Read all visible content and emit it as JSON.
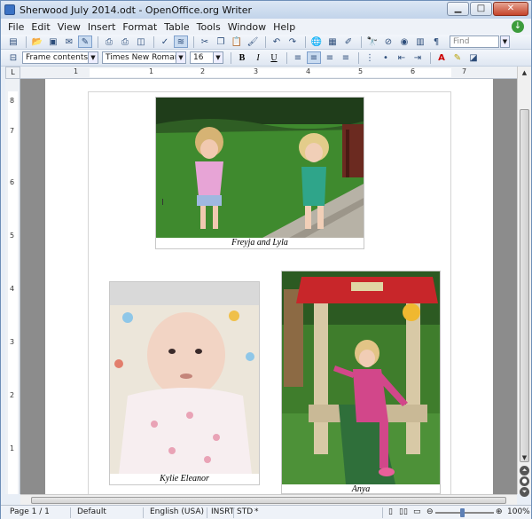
{
  "window": {
    "title": "Sherwood July 2014.odt - OpenOffice.org Writer"
  },
  "menu": [
    {
      "label": "File",
      "u": "F"
    },
    {
      "label": "Edit",
      "u": "E"
    },
    {
      "label": "View",
      "u": "V"
    },
    {
      "label": "Insert",
      "u": "I"
    },
    {
      "label": "Format",
      "u": "o"
    },
    {
      "label": "Table",
      "u": "a"
    },
    {
      "label": "Tools",
      "u": "T"
    },
    {
      "label": "Window",
      "u": "W"
    },
    {
      "label": "Help",
      "u": "H"
    }
  ],
  "toolbar": {
    "find_placeholder": "Find"
  },
  "format_bar": {
    "style": "Frame contents",
    "font": "Times New Roman",
    "size": "16"
  },
  "ruler": {
    "numbers": [
      "1",
      "1",
      "2",
      "3",
      "4",
      "5",
      "6",
      "7"
    ],
    "vnumbers": [
      "1",
      "2",
      "3",
      "4",
      "5",
      "6",
      "7",
      "8"
    ]
  },
  "photos": [
    {
      "caption": "Freyja and Lyla"
    },
    {
      "caption": "Kylie Eleanor"
    },
    {
      "caption": "Anya"
    }
  ],
  "status": {
    "page": "Page 1 / 1",
    "style": "Default",
    "language": "English (USA)",
    "insert_mode": "INSRT",
    "selection_mode": "STD",
    "zoom": "100%"
  },
  "colors": {
    "accent": "#3a72c4",
    "grass": "#3f8a2e",
    "playhouse_red": "#c8262a"
  }
}
